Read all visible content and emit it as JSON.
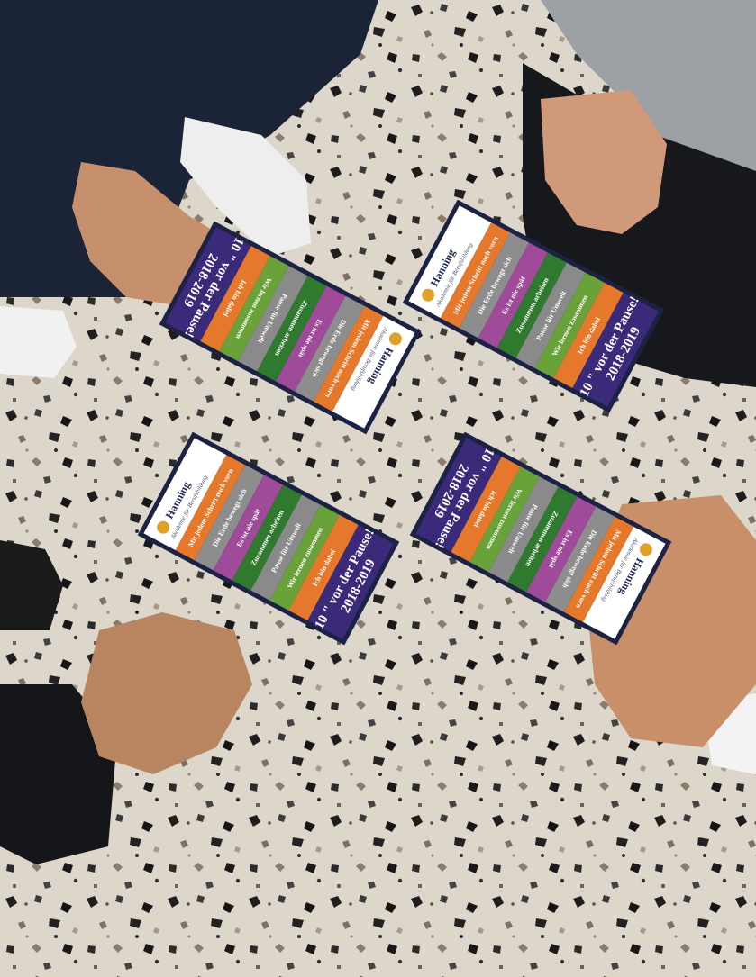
{
  "scene": {
    "description_colors": {
      "floor": "#d9d3c8",
      "card_frame": "#1c2244",
      "card_title_band": "#3b2a7a",
      "bands": [
        "#6aa23a",
        "#8a8a8a",
        "#2f7a2f",
        "#a04a9a",
        "#8d8d8d",
        "#e5782a",
        "#ffffff"
      ]
    }
  },
  "cards": [
    {
      "brand": "Hanning",
      "tagline": "Akademie für Berufsbildung",
      "title_line1": "10 \" vor der Pause!",
      "title_line2": "2018-2019",
      "lines": [
        "Mit jedem Schritt nach vorn",
        "Die Erde bewegt sich",
        "Es ist nie spät",
        "Zusammen arbeiten",
        "Pause für Umwelt",
        "Wir lernen zusammen",
        "Ich bin dabei"
      ]
    },
    {
      "brand": "Hanning",
      "tagline": "Akademie für Berufsbildung",
      "title_line1": "10 \" vor der Pause!",
      "title_line2": "2018-2019",
      "lines": [
        "Mit jedem Schritt nach vorn",
        "Die Erde bewegt sich",
        "Es ist nie spät",
        "Zusammen arbeiten",
        "Pause für Umwelt",
        "Wir lernen zusammen",
        "Ich bin dabei"
      ]
    },
    {
      "brand": "Hanning",
      "tagline": "Akademie für Berufsbildung",
      "title_line1": "10 \" vor der Pause!",
      "title_line2": "2018-2019",
      "lines": [
        "Mit jedem Schritt nach vorn",
        "Die Erde bewegt sich",
        "Es ist nie spät",
        "Zusammen arbeiten",
        "Pause für Umwelt",
        "Wir lernen zusammen",
        "Ich bin dabei"
      ]
    },
    {
      "brand": "Hanning",
      "tagline": "Akademie für Berufsbildung",
      "title_line1": "10 \" vor der Pause!",
      "title_line2": "2018-2019",
      "lines": [
        "Mit jedem Schritt nach vorn",
        "Die Erde bewegt sich",
        "Es ist nie spät",
        "Zusammen arbeiten",
        "Pause für Umwelt",
        "Wir lernen zusammen",
        "Ich bin dabei"
      ]
    }
  ]
}
